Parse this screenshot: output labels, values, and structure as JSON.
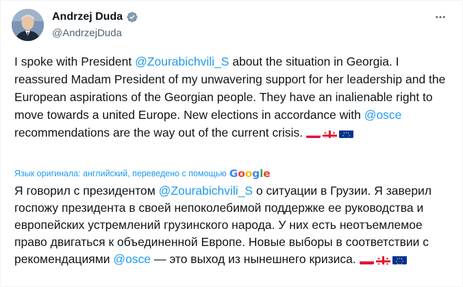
{
  "author": {
    "display_name": "Andrzej Duda",
    "handle": "@AndrzejDuda",
    "verified": true
  },
  "tweet": {
    "text_before_mention": "I spoke with President ",
    "mention_1": "@Zourabichvili_S",
    "text_middle": " about the situation in Georgia. I reassured Madam President of my unwavering support for her leadership and the European aspirations of the Georgian people. They have an inalienable right to move towards a united Europe. New elections in accordance with ",
    "mention_2": "@osce",
    "text_after": " recommendations are the way out of the current crisis. "
  },
  "translation": {
    "label": "Язык оригинала: английский, переведено с помощью",
    "provider": [
      "G",
      "o",
      "o",
      "g",
      "l",
      "e"
    ],
    "text_before_mention": "Я говорил с президентом ",
    "mention_1": "@Zourabichvili_S",
    "text_middle": " о ситуации в Грузии. Я заверил госпожу президента в своей непоколебимой поддержке ее руководства и европейских устремлений грузинского народа. У них есть неотъемлемое право двигаться к объединенной Европе. Новые выборы в соответствии с рекомендациями ",
    "mention_2": "@osce",
    "text_after": " — это выход из нынешнего кризиса. "
  },
  "icons": {
    "verified": "verified-badge-icon",
    "more": "more-options-icon",
    "flags": [
      "poland-flag",
      "georgia-flag",
      "eu-flag"
    ]
  },
  "colors": {
    "accent": "#1d9bf0",
    "text": "#0f1419",
    "secondary": "#536471"
  }
}
